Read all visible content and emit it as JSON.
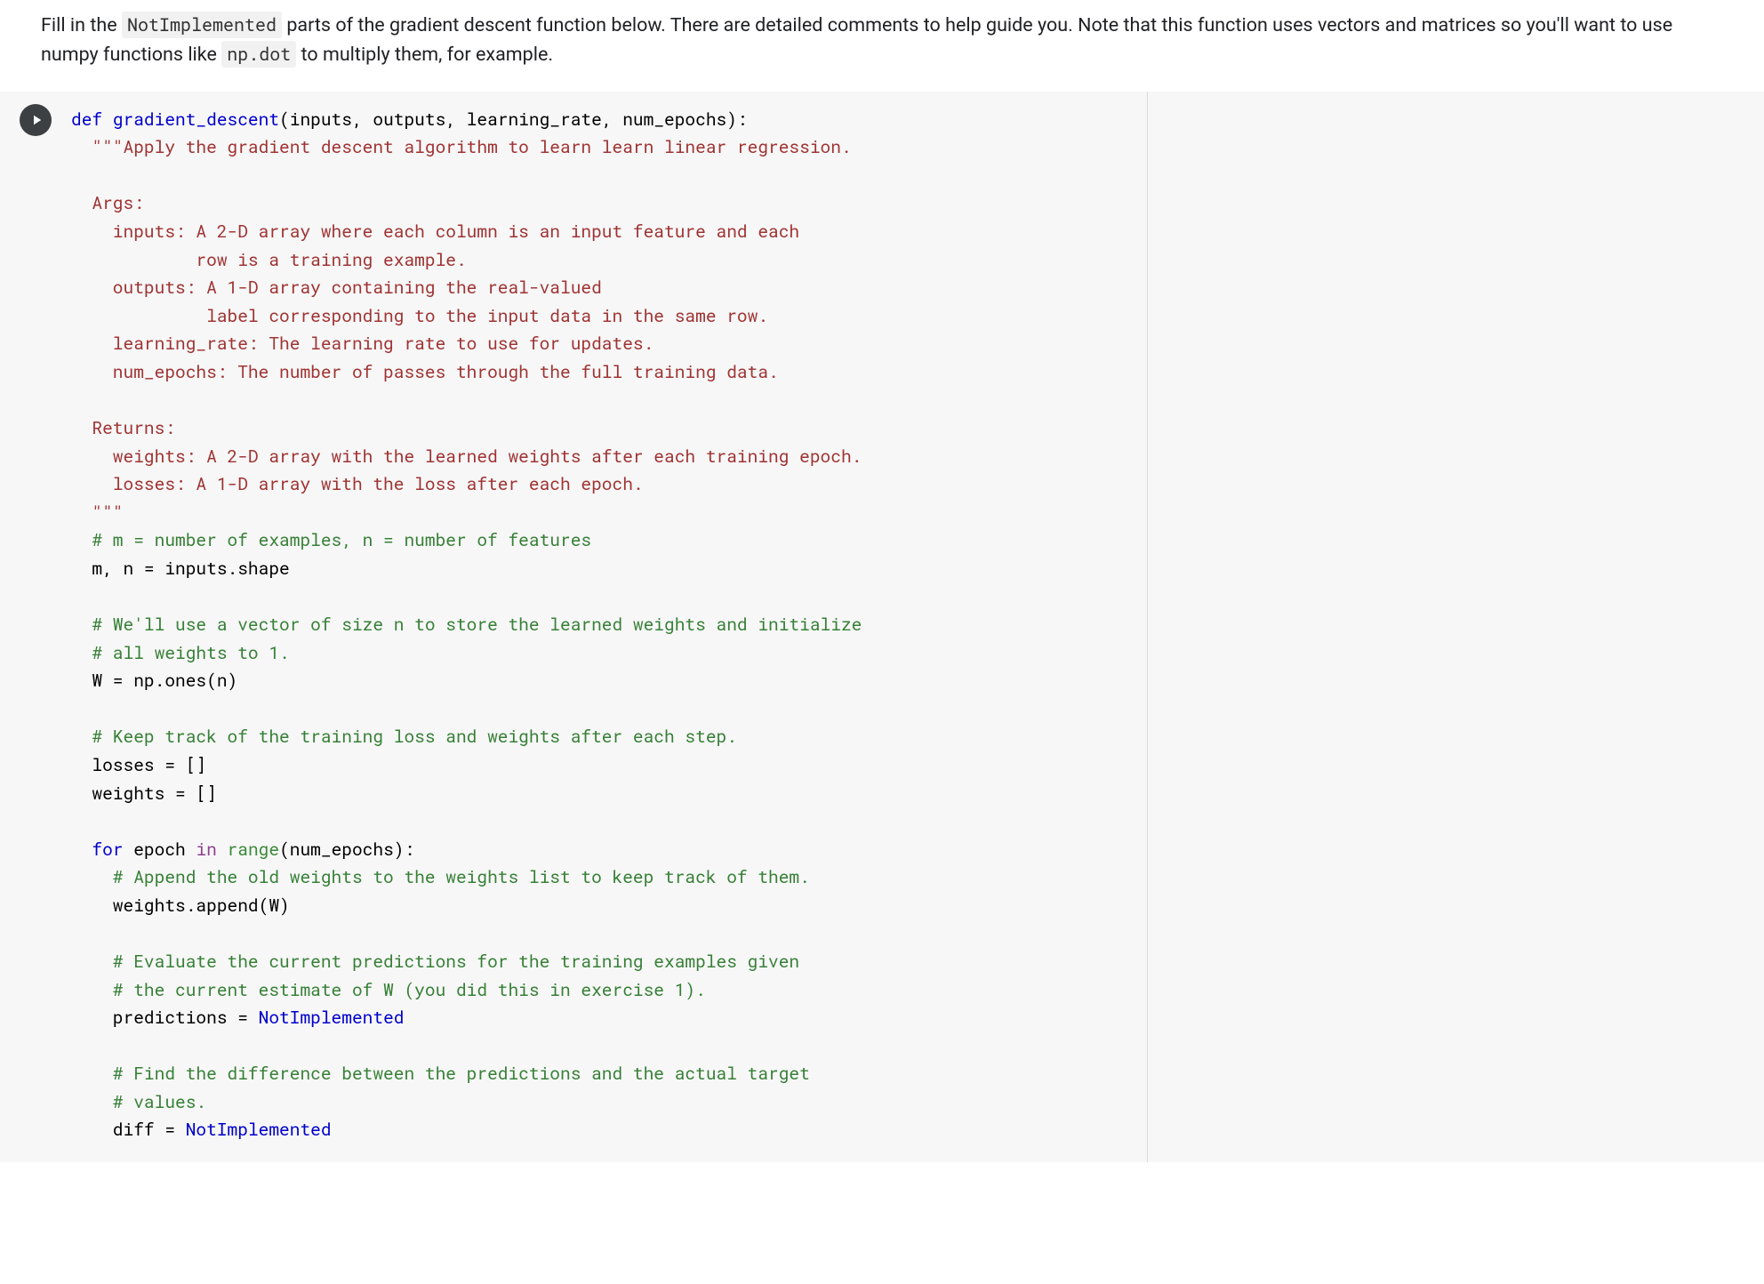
{
  "instruction": {
    "part1": "Fill in the ",
    "code1": "NotImplemented",
    "part2": " parts of the gradient descent function below. There are detailed comments to help guide you. Note that this function uses vectors and matrices so you'll want to use numpy functions like ",
    "code2": "np.dot",
    "part3": " to multiply them, for example."
  },
  "code": {
    "l01_def": "def ",
    "l01_fn": "gradient_descent",
    "l01_params": "(inputs, outputs, learning_rate, num_epochs):",
    "l02": "  \"\"\"Apply the gradient descent algorithm to learn learn linear regression.",
    "l03": "",
    "l04": "  Args:",
    "l05": "    inputs: A 2-D array where each column is an input feature and each",
    "l06": "            row is a training example.",
    "l07": "    outputs: A 1-D array containing the real-valued",
    "l08": "             label corresponding to the input data in the same row.",
    "l09": "    learning_rate: The learning rate to use for updates.",
    "l10": "    num_epochs: The number of passes through the full training data.",
    "l11": "",
    "l12": "  Returns:",
    "l13": "    weights: A 2-D array with the learned weights after each training epoch.",
    "l14": "    losses: A 1-D array with the loss after each epoch.",
    "l15": "  \"\"\"",
    "l16": "  # m = number of examples, n = number of features",
    "l17": "  m, n = inputs.shape",
    "l18": "",
    "l19": "  # We'll use a vector of size n to store the learned weights and initialize",
    "l20": "  # all weights to 1.",
    "l21": "  W = np.ones(n)",
    "l22": "",
    "l23": "  # Keep track of the training loss and weights after each step.",
    "l24": "  losses = []",
    "l25": "  weights = []",
    "l26": "",
    "l27_for": "  for",
    "l27_var": " epoch ",
    "l27_in": "in",
    "l27_range": " range",
    "l27_rest": "(num_epochs):",
    "l28": "    # Append the old weights to the weights list to keep track of them.",
    "l29": "    weights.append(W)",
    "l30": "",
    "l31": "    # Evaluate the current predictions for the training examples given",
    "l32": "    # the current estimate of W (you did this in exercise 1).",
    "l33a": "    predictions = ",
    "l33b": "NotImplemented",
    "l34": "",
    "l35": "    # Find the difference between the predictions and the actual target",
    "l36": "    # values.",
    "l37a": "    diff = ",
    "l37b": "NotImplemented"
  }
}
